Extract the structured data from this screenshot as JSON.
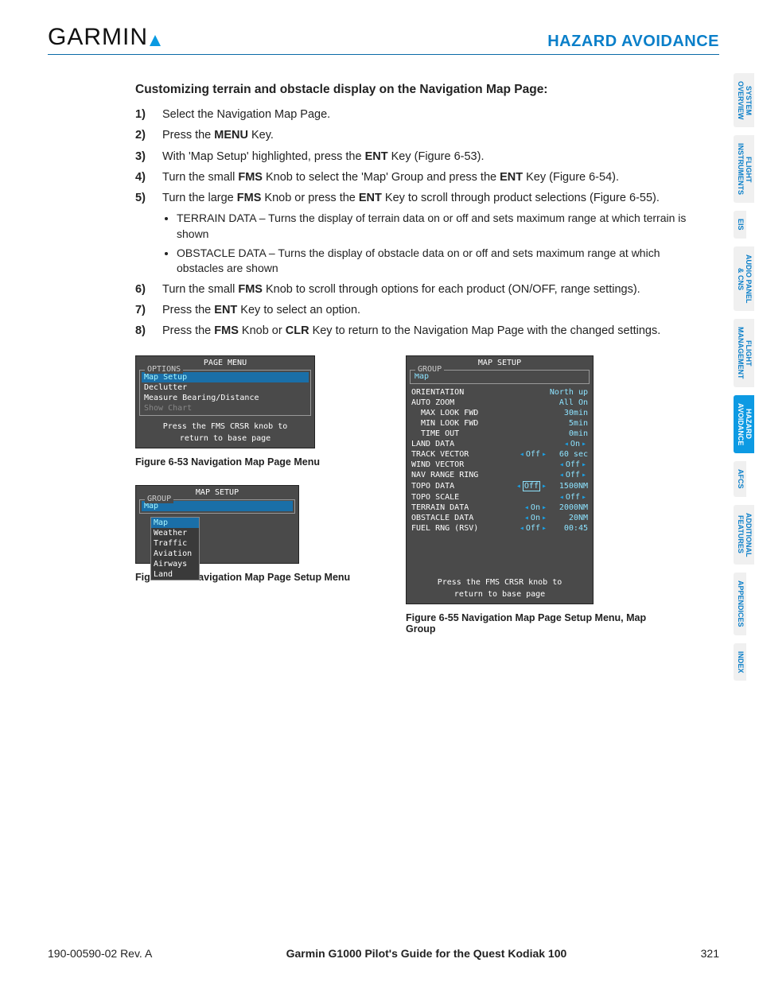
{
  "header": {
    "logo_text": "GARMIN",
    "section": "HAZARD AVOIDANCE"
  },
  "heading": "Customizing terrain and obstacle display on the Navigation Map Page:",
  "steps": [
    {
      "n": "1)",
      "text": "Select the Navigation Map Page."
    },
    {
      "n": "2)",
      "text_parts": [
        "Press the ",
        "MENU",
        " Key."
      ]
    },
    {
      "n": "3)",
      "text_parts": [
        "With 'Map Setup' highlighted, press the ",
        "ENT",
        " Key (Figure 6-53)."
      ]
    },
    {
      "n": "4)",
      "text_parts": [
        "Turn the small ",
        "FMS",
        " Knob to select the 'Map' Group and press the ",
        "ENT",
        " Key (Figure 6-54)."
      ]
    },
    {
      "n": "5)",
      "text_parts": [
        "Turn the large ",
        "FMS",
        " Knob or press the ",
        "ENT",
        " Key to scroll through product selections (Figure 6-55)."
      ]
    },
    {
      "n": "6)",
      "text_parts": [
        "Turn the small ",
        "FMS",
        " Knob to scroll through options for each product (ON/OFF, range settings)."
      ]
    },
    {
      "n": "7)",
      "text_parts": [
        "Press the ",
        "ENT",
        " Key to select an option."
      ]
    },
    {
      "n": "8)",
      "text_parts": [
        "Press the ",
        "FMS",
        " Knob or ",
        "CLR",
        " Key to return to the Navigation Map Page with the changed settings."
      ]
    }
  ],
  "bullets": [
    "TERRAIN DATA – Turns the display of terrain data on or off and sets maximum range at which terrain is shown",
    "OBSTACLE DATA – Turns the display of obstacle data on or off and sets maximum range at which obstacles are shown"
  ],
  "fig53": {
    "title": "PAGE MENU",
    "group": "OPTIONS",
    "rows": [
      "Map Setup",
      "Declutter",
      "Measure Bearing/Distance",
      "Show Chart"
    ],
    "selected": 0,
    "dimmed": 3,
    "info1": "Press the FMS CRSR knob to",
    "info2": "return to base page",
    "caption": "Figure 6-53  Navigation Map Page Menu"
  },
  "fig54": {
    "title": "MAP SETUP",
    "group": "GROUP",
    "value": "Map",
    "options": [
      "Map",
      "Weather",
      "Traffic",
      "Aviation",
      "Airways",
      "Land"
    ],
    "caption": "Figure 6-54  Navigation Map Page Setup Menu"
  },
  "fig55": {
    "title": "MAP SETUP",
    "group": "GROUP",
    "value": "Map",
    "rows": [
      {
        "k": "ORIENTATION",
        "v": "North up"
      },
      {
        "k": "AUTO ZOOM",
        "v": "All On"
      },
      {
        "k": "MAX LOOK FWD",
        "v": "30min",
        "indent": true
      },
      {
        "k": "MIN LOOK FWD",
        "v": "5min",
        "indent": true
      },
      {
        "k": "TIME OUT",
        "v": "0min",
        "indent": true
      },
      {
        "k": "LAND DATA",
        "toggle": "On"
      },
      {
        "k": "TRACK VECTOR",
        "toggle": "Off",
        "v2": "60 sec"
      },
      {
        "k": "WIND VECTOR",
        "toggle": "Off"
      },
      {
        "k": "NAV RANGE RING",
        "toggle": "Off"
      },
      {
        "k": "TOPO DATA",
        "toggle": "Off",
        "boxed": true,
        "v2": "1500NM"
      },
      {
        "k": "TOPO SCALE",
        "toggle": "Off"
      },
      {
        "k": "TERRAIN DATA",
        "toggle": "On",
        "v2": "2000NM"
      },
      {
        "k": "OBSTACLE DATA",
        "toggle": "On",
        "v2": "20NM"
      },
      {
        "k": "FUEL RNG (RSV)",
        "toggle": "Off",
        "v2": "00:45"
      }
    ],
    "info1": "Press the FMS CRSR knob to",
    "info2": "return to base page",
    "caption": "Figure 6-55  Navigation Map Page Setup Menu, Map Group"
  },
  "sidetabs": [
    "SYSTEM\nOVERVIEW",
    "FLIGHT\nINSTRUMENTS",
    "EIS",
    "AUDIO PANEL\n& CNS",
    "FLIGHT\nMANAGEMENT",
    "HAZARD\nAVOIDANCE",
    "AFCS",
    "ADDITIONAL\nFEATURES",
    "APPENDICES",
    "INDEX"
  ],
  "sidetab_active": 5,
  "footer": {
    "left": "190-00590-02  Rev. A",
    "mid": "Garmin G1000 Pilot's Guide for the Quest Kodiak 100",
    "right": "321"
  }
}
